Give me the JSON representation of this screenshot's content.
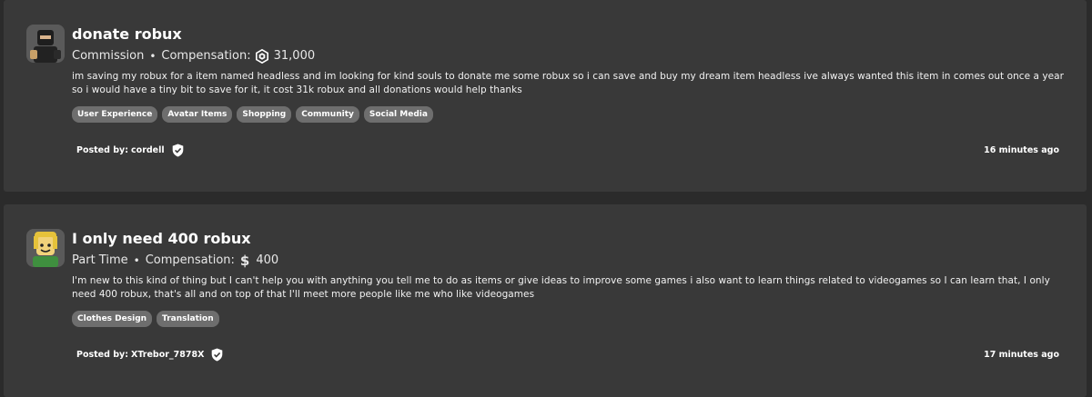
{
  "posts": [
    {
      "title": "donate robux",
      "job_type": "Commission",
      "compensation_label": "Compensation:",
      "compensation_icon": "robux-icon",
      "compensation_value": "31,000",
      "description": "im saving my robux for a item named headless and im looking for kind souls to donate me some robux so i can save and buy my dream item headless ive always wanted this item in comes out once a year so i would have a tiny bit to save for it, it cost 31k robux and all donations would help thanks",
      "tags": [
        "User Experience",
        "Avatar Items",
        "Shopping",
        "Community",
        "Social Media"
      ],
      "posted_by_label": "Posted by:",
      "author": "cordell",
      "time": "16 minutes ago"
    },
    {
      "title": "I only need 400 robux",
      "job_type": "Part Time",
      "compensation_label": "Compensation:",
      "compensation_icon": "dollar-icon",
      "compensation_symbol": "$",
      "compensation_value": "400",
      "description": "I'm new to this kind of thing but I can't help you with anything you tell me to do as items or give ideas to improve some games i also want to learn things related to videogames so I can learn that, I only need 400 robux, that's all and on top of that I'll meet more people like me who like videogames",
      "tags": [
        "Clothes Design",
        "Translation"
      ],
      "posted_by_label": "Posted by:",
      "author": "XTrebor_7878X",
      "time": "17 minutes ago"
    }
  ],
  "colors": {
    "background": "#2b2b2b",
    "card": "#393939",
    "tag": "#6e6e6e",
    "text": "#ffffff"
  },
  "separator": "•"
}
